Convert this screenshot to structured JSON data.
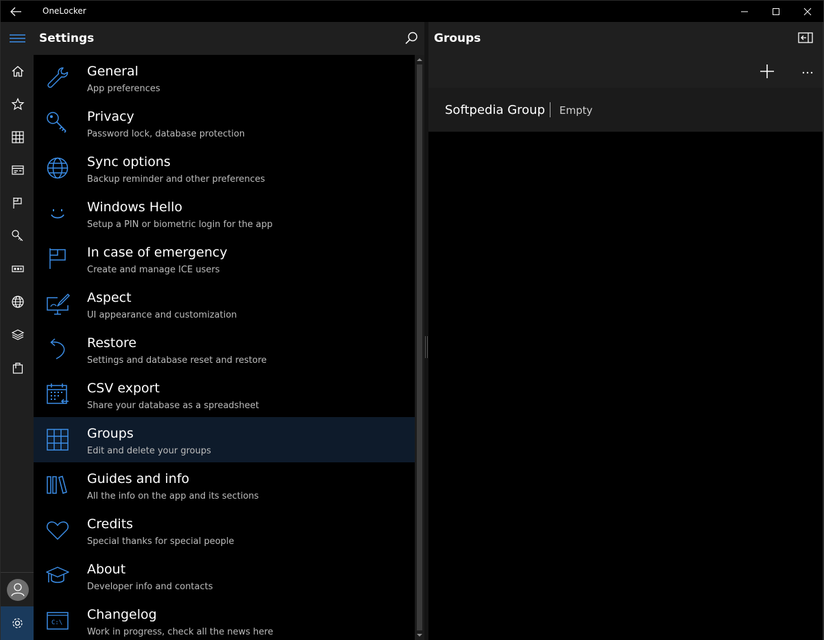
{
  "window": {
    "app_title": "OneLocker"
  },
  "rail": {
    "items": [
      {
        "icon": "home-icon"
      },
      {
        "icon": "star-icon"
      },
      {
        "icon": "grid-icon"
      },
      {
        "icon": "card-icon"
      },
      {
        "icon": "flag-icon"
      },
      {
        "icon": "key-icon"
      },
      {
        "icon": "badge-icon"
      },
      {
        "icon": "globe-icon"
      },
      {
        "icon": "layers-icon"
      },
      {
        "icon": "shopping-bag-icon"
      }
    ]
  },
  "settings": {
    "title": "Settings",
    "items": [
      {
        "label": "General",
        "sub": "App preferences",
        "icon": "wrench-icon"
      },
      {
        "label": "Privacy",
        "sub": "Password lock, database protection",
        "icon": "key-icon"
      },
      {
        "label": "Sync options",
        "sub": "Backup reminder and other preferences",
        "icon": "globe-icon"
      },
      {
        "label": "Windows Hello",
        "sub": "Setup a PIN or biometric login for the app",
        "icon": "smile-icon"
      },
      {
        "label": "In case of emergency",
        "sub": "Create and manage ICE users",
        "icon": "flag-icon"
      },
      {
        "label": "Aspect",
        "sub": "UI appearance and customization",
        "icon": "monitor-brush-icon"
      },
      {
        "label": "Restore",
        "sub": "Settings and database reset and restore",
        "icon": "undo-icon"
      },
      {
        "label": "CSV export",
        "sub": "Share your database as a spreadsheet",
        "icon": "calendar-export-icon"
      },
      {
        "label": "Groups",
        "sub": "Edit and delete your groups",
        "icon": "grid-icon",
        "selected": true
      },
      {
        "label": "Guides and info",
        "sub": "All the info on the app and its sections",
        "icon": "library-icon"
      },
      {
        "label": "Credits",
        "sub": "Special thanks for special people",
        "icon": "heart-icon"
      },
      {
        "label": "About",
        "sub": "Developer info and contacts",
        "icon": "graduation-cap-icon"
      },
      {
        "label": "Changelog",
        "sub": "Work in progress, check all the news here",
        "icon": "console-icon"
      }
    ]
  },
  "groups": {
    "title": "Groups",
    "rows": [
      {
        "name": "Softpedia Group",
        "status": "Empty"
      }
    ]
  },
  "colors": {
    "accent": "#2f7ee0",
    "selected_bg": "#0e1b2b",
    "rail_bg": "#1f1f1f"
  }
}
